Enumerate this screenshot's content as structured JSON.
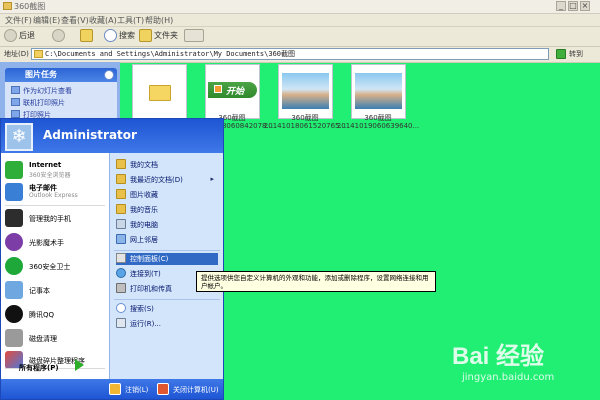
{
  "window": {
    "title": "360截图",
    "buttons": [
      "_",
      "□",
      "×"
    ]
  },
  "menubar": [
    "文件(F)",
    "编辑(E)",
    "查看(V)",
    "收藏(A)",
    "工具(T)",
    "帮助(H)"
  ],
  "toolbar": {
    "back_label": "后退",
    "search_label": "搜索",
    "folders_label": "文件夹"
  },
  "address": {
    "label": "地址(D)",
    "path": "C:\\Documents and Settings\\Administrator\\My Documents\\360截图",
    "go_label": "转到"
  },
  "task_pane": {
    "header": "图片任务",
    "items": [
      "作为幻灯片查看",
      "联机打印照片",
      "打印照片"
    ]
  },
  "files": [
    {
      "name": "",
      "sub": "",
      "kind": "folder"
    },
    {
      "name": "360截图",
      "sub": "20141018060842078...",
      "kind": "start-button"
    },
    {
      "name": "360截图",
      "sub": "20141018061520765...",
      "kind": "photo"
    },
    {
      "name": "360截图",
      "sub": "20141019060639640...",
      "kind": "photo"
    }
  ],
  "thumbnail_start_text": "开始",
  "start_menu": {
    "user": "Administrator",
    "pinned": [
      {
        "name": "Internet",
        "sub": "360安全浏览器"
      },
      {
        "name": "电子邮件",
        "sub": "Outlook Express"
      }
    ],
    "recent": [
      "管理我的手机",
      "光影魔术手",
      "360安全卫士",
      "记事本",
      "腾讯QQ",
      "磁盘清理",
      "磁盘碎片整理程序"
    ],
    "all_programs": "所有程序(P)",
    "right": [
      "我的文档",
      "我最近的文档(D)",
      "图片收藏",
      "我的音乐",
      "我的电脑",
      "网上邻居",
      "控制面板(C)",
      "连接到(T)",
      "打印机和传真",
      "搜索(S)",
      "运行(R)..."
    ],
    "logoff": "注销(L)",
    "shutdown": "关闭计算机(U)"
  },
  "tooltip": "提供选项供您自定义计算机的外观和功能，添加或删除程序，设置网络连接和用户帐户。",
  "watermark": {
    "logo": "Bai 经验",
    "url": "jingyan.baidu.com"
  },
  "colors": {
    "desktop": "#21ef73",
    "start_blue": "#1e55d4",
    "selected": "#316ac5"
  }
}
